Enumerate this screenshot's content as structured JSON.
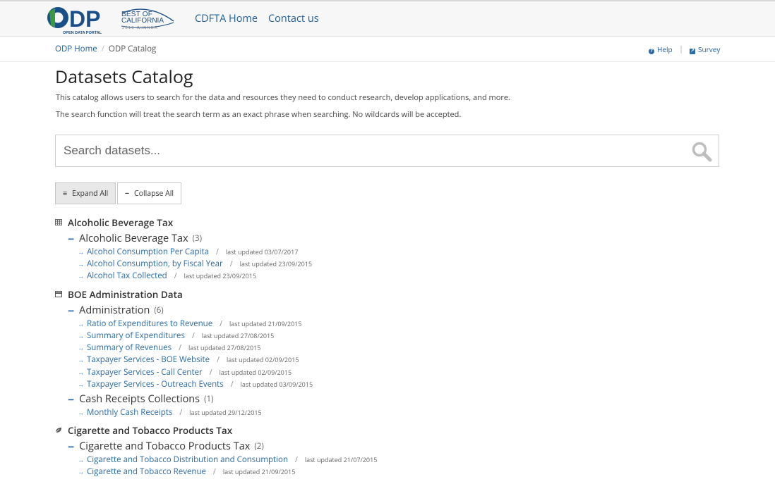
{
  "logo": {
    "text": "ODP",
    "subtitle": "OPEN DATA PORTAL"
  },
  "award": {
    "line1": "BEST OF",
    "line2": "CALIFORNIA",
    "line3": "2016 WINNER"
  },
  "nav": {
    "home": "CDFTA Home",
    "contact": "Contact us"
  },
  "breadcrumb": {
    "home": "ODP Home",
    "separator": "/",
    "current": "ODP Catalog"
  },
  "utility": {
    "help": "Help",
    "divider": "|",
    "survey": "Survey"
  },
  "page": {
    "title": "Datasets Catalog",
    "intro1": "This catalog allows users to search for the data and resources they need to conduct research, develop applications, and more.",
    "intro2": "The search function will treat the search term as an exact phrase when searching. No wildcards will be accepted."
  },
  "search": {
    "placeholder": "Search datasets..."
  },
  "buttons": {
    "expand": "Expand All",
    "collapse": "Collapse All"
  },
  "catalog": [
    {
      "name": "Alcoholic Beverage Tax",
      "icon": "table-icon",
      "groups": [
        {
          "name": "Alcoholic Beverage Tax",
          "count": "(3)",
          "items": [
            {
              "title": "Alcohol Consumption Per Capita",
              "updated": "last updated 03/07/2017"
            },
            {
              "title": "Alcohol Consumption, by Fiscal Year",
              "updated": "last updated 23/09/2015"
            },
            {
              "title": "Alcohol Tax Collected",
              "updated": "last updated 23/09/2015"
            }
          ]
        }
      ]
    },
    {
      "name": "BOE Administration Data",
      "icon": "card-icon",
      "groups": [
        {
          "name": "Administration",
          "count": "(6)",
          "items": [
            {
              "title": "Ratio of Expenditures to Revenue",
              "updated": "last updated 21/09/2015"
            },
            {
              "title": "Summary of Expenditures",
              "updated": "last updated 27/08/2015"
            },
            {
              "title": "Summary of Revenues",
              "updated": "last updated 27/08/2015"
            },
            {
              "title": "Taxpayer Services - BOE Website",
              "updated": "last updated 02/09/2015"
            },
            {
              "title": "Taxpayer Services - Call Center",
              "updated": "last updated 02/09/2015"
            },
            {
              "title": "Taxpayer Services - Outreach Events",
              "updated": "last updated 03/09/2015"
            }
          ]
        },
        {
          "name": "Cash Receipts Collections",
          "count": "(1)",
          "items": [
            {
              "title": "Monthly Cash Receipts",
              "updated": "last updated 29/12/2015"
            }
          ]
        }
      ]
    },
    {
      "name": "Cigarette and Tobacco Products Tax",
      "icon": "leaf-icon",
      "groups": [
        {
          "name": "Cigarette and Tobacco Products Tax",
          "count": "(2)",
          "items": [
            {
              "title": "Cigarette and Tobacco Distribution and Consumption",
              "updated": "last updated 21/07/2015"
            },
            {
              "title": "Cigarette and Tobacco Revenue",
              "updated": "last updated 21/09/2015"
            }
          ]
        }
      ]
    }
  ],
  "colors": {
    "link": "#2a6aa8",
    "brand": "#1b4f8a",
    "logo_green": "#3b9a3f"
  }
}
